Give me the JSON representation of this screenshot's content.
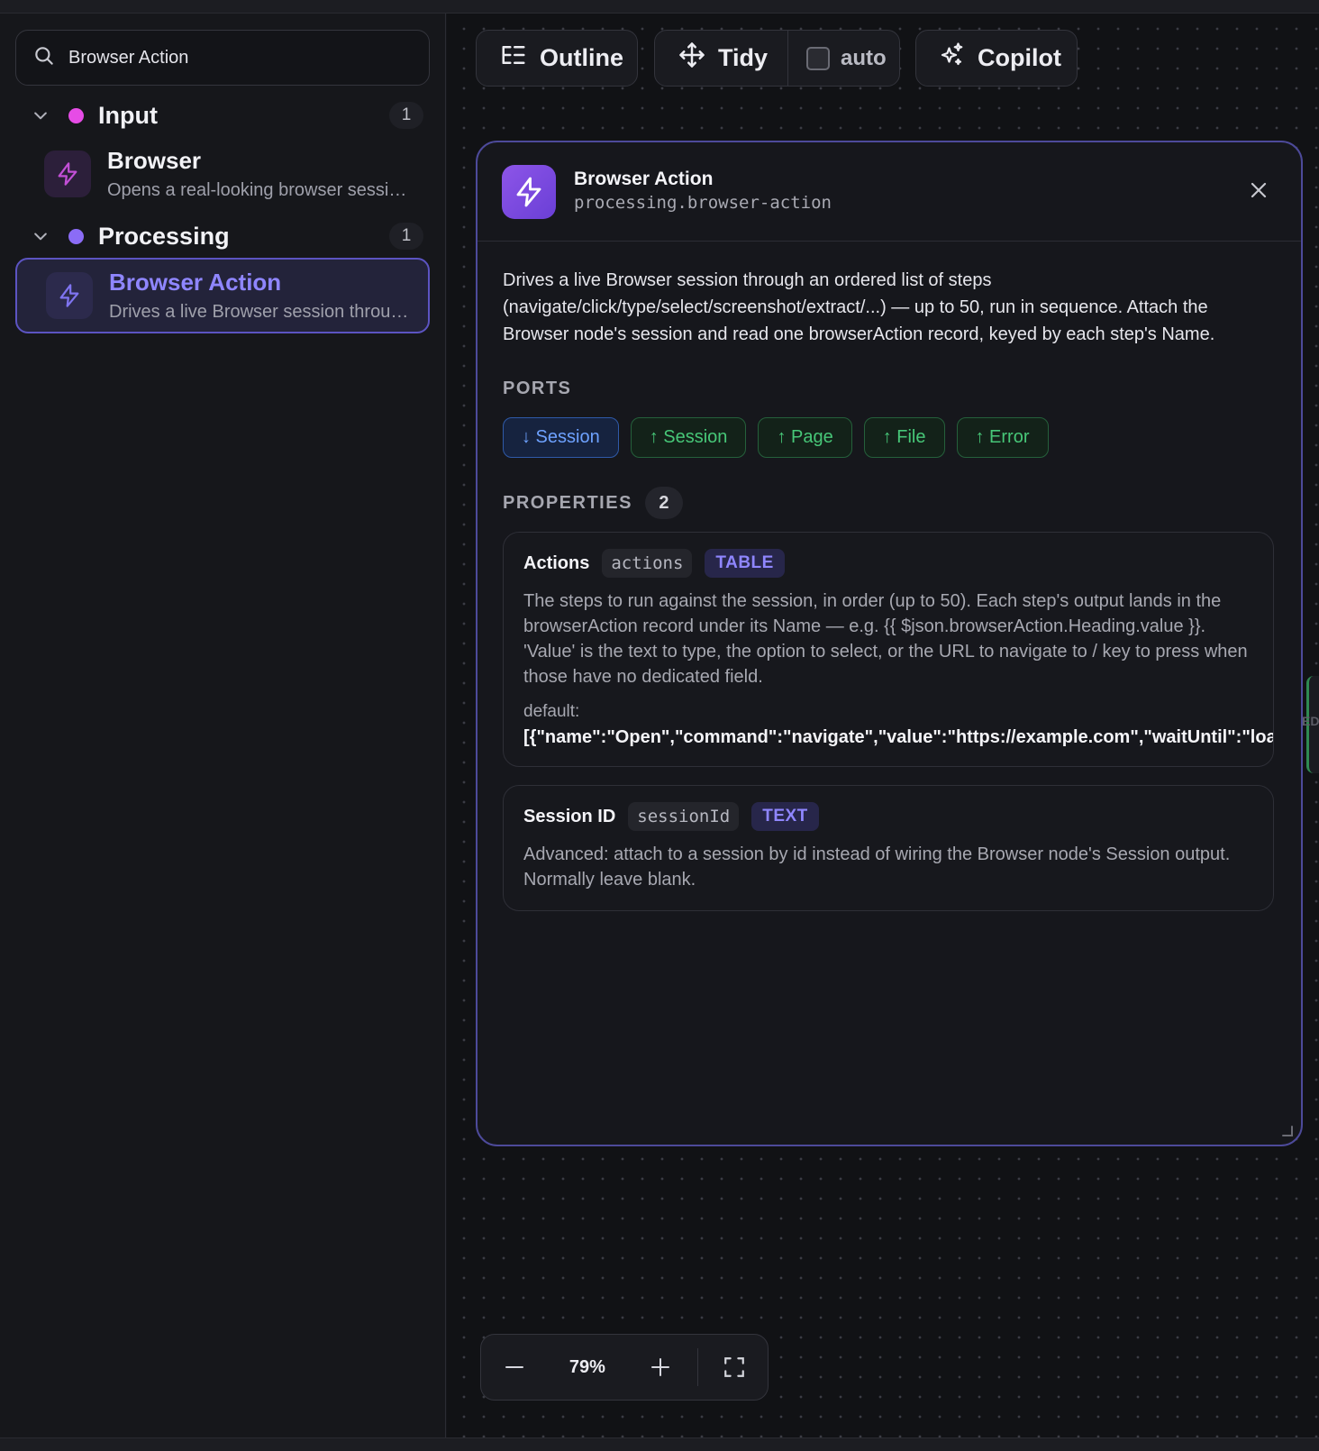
{
  "search": {
    "value": "Browser Action",
    "icon": "search-icon"
  },
  "sidebar": {
    "groups": [
      {
        "title": "Input",
        "count": "1",
        "color": "#e64ce6",
        "items": [
          {
            "title": "Browser",
            "desc": "Opens a real-looking browser session for downstream nodes",
            "icon": "lightning-icon"
          }
        ]
      },
      {
        "title": "Processing",
        "count": "1",
        "color": "#8b6cf6",
        "items": [
          {
            "title": "Browser Action",
            "desc": "Drives a live Browser session through an ordered list of steps",
            "icon": "lightning-icon"
          }
        ]
      }
    ]
  },
  "toolbar": {
    "outline": "Outline",
    "tidy": "Tidy",
    "auto": "auto",
    "copilot": "Copilot"
  },
  "panel": {
    "title": "Browser Action",
    "slug": "processing.browser-action",
    "description": "Drives a live Browser session through an ordered list of steps (navigate/click/type/select/screenshot/extract/...) — up to 50, run in sequence. Attach the Browser node's session and read one browserAction record, keyed by each step's Name.",
    "ports_label": "PORTS",
    "ports": [
      {
        "label": "↓ Session",
        "dir": "in"
      },
      {
        "label": "↑ Session",
        "dir": "out"
      },
      {
        "label": "↑ Page",
        "dir": "out"
      },
      {
        "label": "↑ File",
        "dir": "out"
      },
      {
        "label": "↑ Error",
        "dir": "out"
      }
    ],
    "properties_label": "PROPERTIES",
    "properties_count": "2",
    "properties": [
      {
        "name": "Actions",
        "key": "actions",
        "type": "TABLE",
        "desc": "The steps to run against the session, in order (up to 50). Each step's output lands in the browserAction record under its Name — e.g. {{ $json.browserAction.Heading.value }}. 'Value' is the text to type, the option to select, or the URL to navigate to / key to press when those have no dedicated field.",
        "default_label": "default:",
        "default": "[{\"name\":\"Open\",\"command\":\"navigate\",\"value\":\"https://example.com\",\"waitUntil\":\"load\","
      },
      {
        "name": "Session ID",
        "key": "sessionId",
        "type": "TEXT",
        "desc": "Advanced: attach to a session by id instead of wiring the Browser node's Session output. Normally leave blank."
      }
    ]
  },
  "canvas_edge_text": "ED",
  "zoom": {
    "value": "79%"
  }
}
